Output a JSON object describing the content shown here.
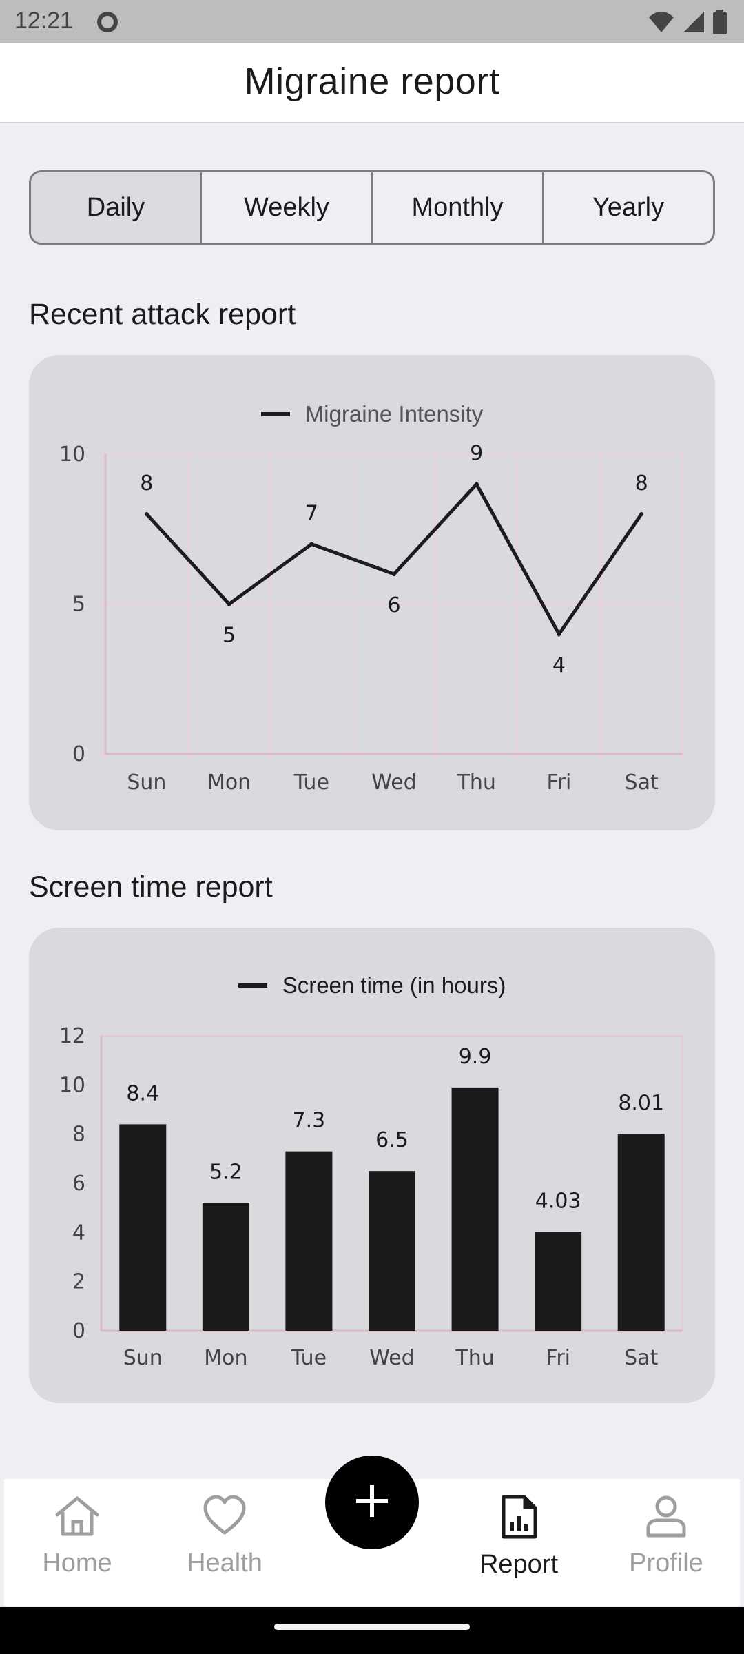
{
  "status_bar": {
    "time": "12:21"
  },
  "app_bar": {
    "title": "Migraine report"
  },
  "period_tabs": [
    {
      "label": "Daily",
      "selected": true
    },
    {
      "label": "Weekly",
      "selected": false
    },
    {
      "label": "Monthly",
      "selected": false
    },
    {
      "label": "Yearly",
      "selected": false
    }
  ],
  "sections": {
    "attack_title": "Recent attack report",
    "screen_title": "Screen time report"
  },
  "chart_data": [
    {
      "type": "line",
      "legend": "Migraine Intensity",
      "categories": [
        "Sun",
        "Mon",
        "Tue",
        "Wed",
        "Thu",
        "Fri",
        "Sat"
      ],
      "series": [
        {
          "name": "Migraine Intensity",
          "values": [
            8,
            5,
            7,
            6,
            9,
            4,
            8
          ]
        }
      ],
      "data_labels": [
        "8",
        "5",
        "7",
        "6",
        "9",
        "4",
        "8"
      ],
      "ylim": [
        0,
        10
      ],
      "yticks": [
        "0",
        "5",
        "10"
      ],
      "grid": true,
      "legend_position": "top-center",
      "line_color": "#1c1b1f"
    },
    {
      "type": "bar",
      "legend": "Screen time (in hours)",
      "categories": [
        "Sun",
        "Mon",
        "Tue",
        "Wed",
        "Thu",
        "Fri",
        "Sat"
      ],
      "series": [
        {
          "name": "Screen time (in hours)",
          "values": [
            8.4,
            5.2,
            7.3,
            6.5,
            9.9,
            4.03,
            8.01
          ]
        }
      ],
      "data_labels": [
        "8.4",
        "5.2",
        "7.3",
        "6.5",
        "9.9",
        "4.03",
        "8.01"
      ],
      "ylim": [
        0,
        12
      ],
      "yticks": [
        "0",
        "2",
        "4",
        "6",
        "8",
        "10",
        "12"
      ],
      "grid": false,
      "legend_position": "top-center",
      "bar_color": "#1a1a1a"
    }
  ],
  "bottom_nav": {
    "items": [
      {
        "label": "Home",
        "icon": "home-icon",
        "active": false
      },
      {
        "label": "Health",
        "icon": "heart-icon",
        "active": false
      },
      {
        "label": "Report",
        "icon": "report-icon",
        "active": true
      },
      {
        "label": "Profile",
        "icon": "person-icon",
        "active": false
      }
    ],
    "fab_icon": "plus-icon"
  },
  "colors": {
    "background": "#efeef3",
    "card": "#dad9de",
    "active_nav": "#1b1b1b",
    "inactive_nav": "#9e9e9e"
  }
}
